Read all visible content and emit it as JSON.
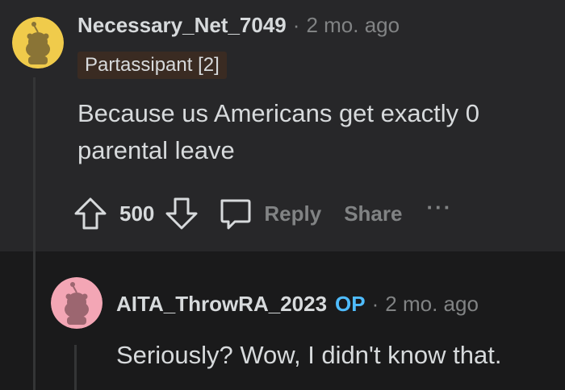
{
  "comment": {
    "username": "Necessary_Net_7049",
    "separator": "·",
    "time": "2 mo. ago",
    "flair": "Partassipant [2]",
    "text_line1": "Because us Americans get exactly 0",
    "text_line2": "parental leave",
    "votes": "500",
    "reply_label": "Reply",
    "share_label": "Share",
    "more_label": "···",
    "avatar_color": "#f0cb4b"
  },
  "reply": {
    "username": "AITA_ThrowRA_2023",
    "op_badge": "OP",
    "separator": "·",
    "time": "2 mo. ago",
    "text": "Seriously? Wow, I didn't know that.",
    "avatar_color": "#f3a6b5"
  },
  "colors": {
    "background": "#1a1a1b",
    "panel": "#272729",
    "text": "#d7dadc",
    "muted": "#818384",
    "op": "#4fbcff"
  }
}
